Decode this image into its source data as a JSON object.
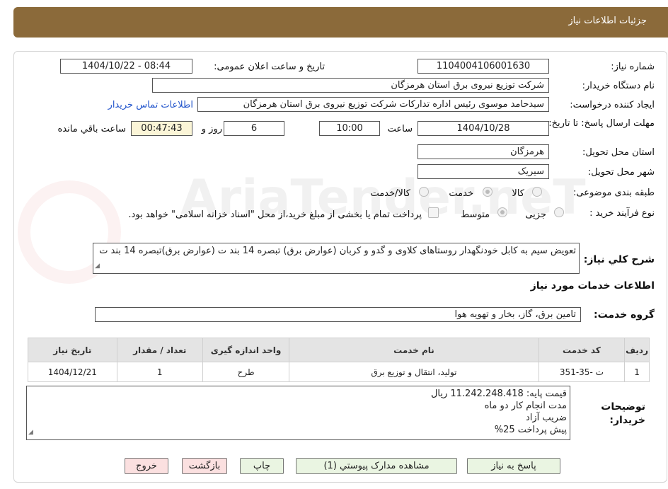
{
  "header": {
    "title": "جزئیات اطلاعات نیاز"
  },
  "fields": {
    "need_number_label": "شماره نیاز:",
    "need_number": "1104004106001630",
    "announce_label": "تاریخ و ساعت اعلان عمومی:",
    "announce_value": "1404/10/22 - 08:44",
    "buyer_org_label": "نام دستگاه خریدار:",
    "buyer_org": "شرکت توزیع نیروی برق استان هرمزگان",
    "requester_label": "ایجاد کننده درخواست:",
    "requester": "سیدحامد موسوی رئیس اداره تداركات شرکت توزیع نیروی برق استان هرمزگان",
    "contact_link": "اطلاعات تماس خریدار",
    "deadline_label": "مهلت ارسال پاسخ: تا تاریخ:",
    "deadline_date": "1404/10/28",
    "time_label": "ساعت",
    "deadline_time": "10:00",
    "days_value": "6",
    "days_label": "روز و",
    "remaining_time": "00:47:43",
    "remaining_label": "ساعت باقي مانده",
    "province_label": "استان محل تحویل:",
    "province": "هرمزگان",
    "city_label": "شهر محل تحویل:",
    "city": "سیریک",
    "category_label": "طبقه بندی موضوعی:",
    "category_options": [
      "کالا",
      "خدمت",
      "کالا/خدمت"
    ],
    "process_label": "نوع فرآیند خرید :",
    "process_options": [
      "جزیی",
      "متوسط"
    ],
    "payment_note": "پرداخت تمام یا بخشی از مبلغ خرید،از محل \"اسناد خزانه اسلامی\" خواهد بود."
  },
  "summary": {
    "label": "شرح کلي نیاز:",
    "text": "تعویض سیم به کابل خودنگهدار روستاهای کلاوی و گدو و کربان (عوارض برق)  تبصره 14 بند ت (عوارض برق)تبصره 14 بند ت"
  },
  "services": {
    "section_title": "اطلاعات خدمات مورد نیاز",
    "group_label": "گروه خدمت:",
    "group_value": "تامین برق، گاز، بخار و تهویه هوا",
    "columns": [
      "ردیف",
      "کد خدمت",
      "نام خدمت",
      "واحد اندازه گیری",
      "تعداد / مقدار",
      "تاریخ نیاز"
    ],
    "rows": [
      [
        "1",
        "ت -35-351",
        "تولید، انتقال و توزیع برق",
        "طرح",
        "1",
        "1404/12/21"
      ]
    ]
  },
  "buyer_notes": {
    "label": "توضیحات خریدار:",
    "lines": [
      "قیمت پایه:  11.242.248.418 ریال",
      "مدت انجام کار دو ماه",
      "ضریب آزاد",
      "پیش پرداخت 25%"
    ]
  },
  "buttons": {
    "respond": "پاسخ به نیاز",
    "attachments": "مشاهده مدارک پیوستي (1)",
    "print": "چاپ",
    "back": "بازگشت",
    "exit": "خروج"
  },
  "watermark": "AriaTender.neT",
  "colors": {
    "header_bg": "#8b6a3a",
    "button_green": "#eaf5e2",
    "button_pink": "#fbe0e0",
    "link": "#2255cc"
  }
}
